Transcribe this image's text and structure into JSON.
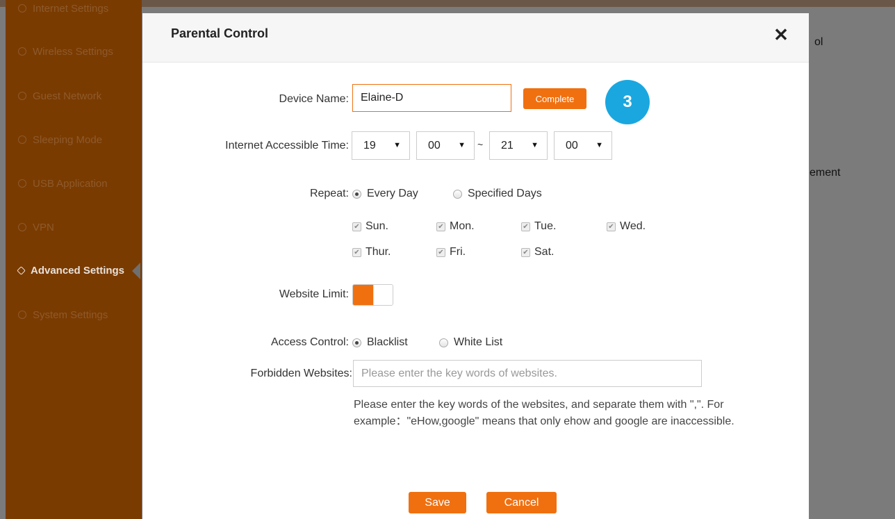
{
  "background": {
    "sidebar": {
      "items": [
        {
          "label": "Internet Settings",
          "icon": "globe-icon",
          "active": false
        },
        {
          "label": "Wireless Settings",
          "icon": "wifi-icon",
          "active": false
        },
        {
          "label": "Guest Network",
          "icon": "guest-icon",
          "active": false
        },
        {
          "label": "Sleeping Mode",
          "icon": "moon-icon",
          "active": false
        },
        {
          "label": "USB Application",
          "icon": "usb-icon",
          "active": false
        },
        {
          "label": "VPN",
          "icon": "vpn-icon",
          "active": false
        },
        {
          "label": "Advanced Settings",
          "icon": "wrench-icon",
          "active": true
        },
        {
          "label": "System Settings",
          "icon": "gear-icon",
          "active": false
        }
      ]
    },
    "right_partial": [
      "ol",
      "ement"
    ]
  },
  "modal": {
    "title": "Parental Control",
    "close_icon": "close-icon",
    "device_name": {
      "label": "Device Name:",
      "value": "Elaine-D",
      "complete_label": "Complete"
    },
    "step_badge": "3",
    "time": {
      "label": "Internet Accessible Time:",
      "start_hour": "19",
      "start_minute": "00",
      "separator": "~",
      "end_hour": "21",
      "end_minute": "00"
    },
    "repeat": {
      "label": "Repeat:",
      "options": [
        "Every Day",
        "Specified Days"
      ],
      "selected": "Every Day",
      "days": [
        "Sun.",
        "Mon.",
        "Tue.",
        "Wed.",
        "Thur.",
        "Fri.",
        "Sat."
      ]
    },
    "website_limit": {
      "label": "Website Limit:",
      "enabled": true
    },
    "access_control": {
      "label": "Access Control:",
      "options": [
        "Blacklist",
        "White List"
      ],
      "selected": "Blacklist"
    },
    "forbidden": {
      "label": "Forbidden Websites:",
      "placeholder": "Please enter the key words of websites.",
      "value": ""
    },
    "hint": "Please enter the key words of the websites, and separate them with \",\". For example：\"eHow,google\" means that only ehow and google are inaccessible.",
    "buttons": {
      "save": "Save",
      "cancel": "Cancel"
    },
    "colors": {
      "accent": "#f07010",
      "badge": "#1aa7e0",
      "sidebar": "#7a3b01"
    }
  }
}
